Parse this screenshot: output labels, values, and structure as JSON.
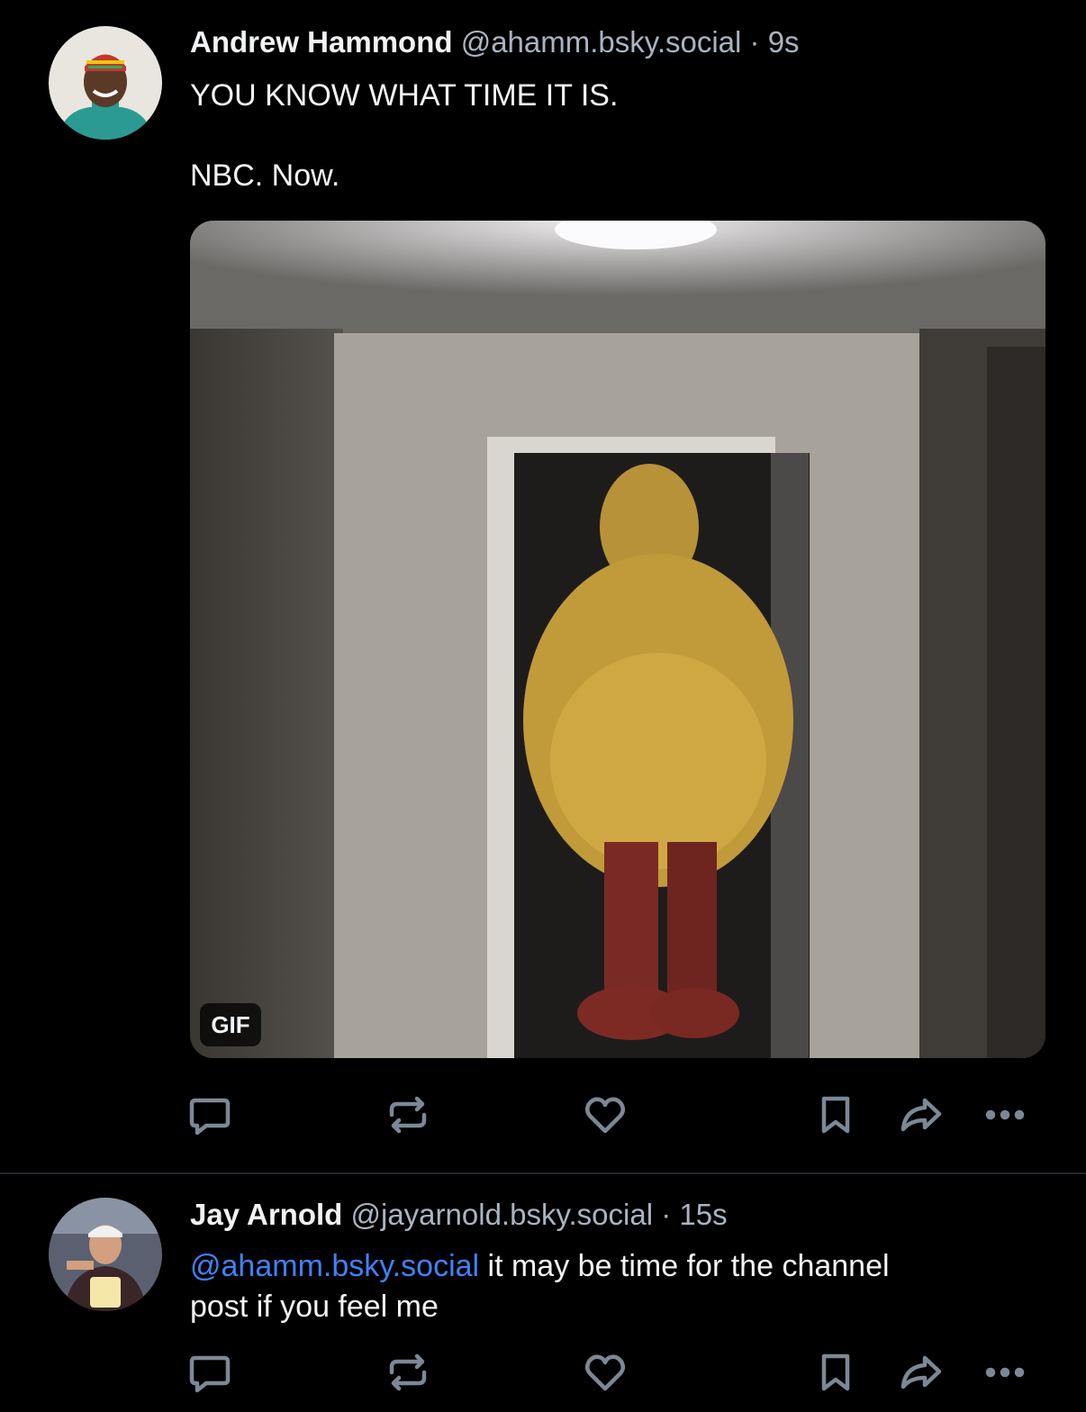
{
  "posts": [
    {
      "author_name": "Andrew Hammond",
      "handle": "@ahamm.bsky.social",
      "separator": "·",
      "time": "9s",
      "line1": "YOU KNOW WHAT TIME IT IS.",
      "line2": "NBC. Now.",
      "media_badge": "GIF"
    },
    {
      "author_name": "Jay Arnold",
      "handle": "@jayarnold.bsky.social",
      "separator": "·",
      "time": "15s",
      "mention": "@ahamm.bsky.social",
      "text_after_mention": " it may be time for the channel",
      "line2": "post if you feel me"
    }
  ],
  "actions": [
    "reply-icon",
    "repost-icon",
    "like-icon",
    "bookmark-icon",
    "share-icon",
    "more-icon"
  ],
  "colors": {
    "background": "#000000",
    "text": "#f1f3f5",
    "muted": "#aab4c1",
    "icon": "#7c8896",
    "mention": "#3f82f7"
  }
}
